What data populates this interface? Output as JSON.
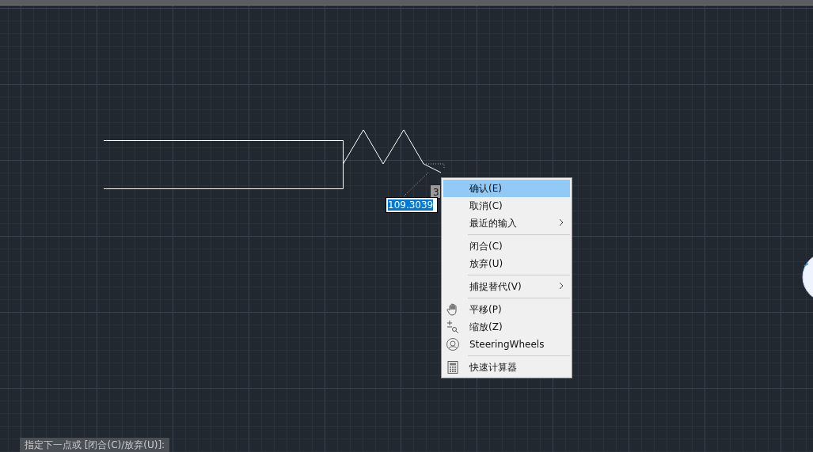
{
  "dimension_input": {
    "value": "109.3039"
  },
  "angle_tooltip": {
    "text": "3"
  },
  "context_menu": {
    "items": [
      {
        "kind": "text",
        "label": "确认(E)",
        "selected": true,
        "submenu": false
      },
      {
        "kind": "text",
        "label": "取消(C)",
        "selected": false,
        "submenu": false
      },
      {
        "kind": "text",
        "label": "最近的输入",
        "selected": false,
        "submenu": true
      },
      {
        "kind": "separator"
      },
      {
        "kind": "text",
        "label": "闭合(C)",
        "selected": false,
        "submenu": false
      },
      {
        "kind": "text",
        "label": "放弃(U)",
        "selected": false,
        "submenu": false
      },
      {
        "kind": "separator"
      },
      {
        "kind": "text",
        "label": "捕捉替代(V)",
        "selected": false,
        "submenu": true
      },
      {
        "kind": "separator"
      },
      {
        "kind": "hand",
        "label": "平移(P)",
        "selected": false,
        "submenu": false
      },
      {
        "kind": "zoom",
        "label": "缩放(Z)",
        "selected": false,
        "submenu": false
      },
      {
        "kind": "wheel",
        "label": "SteeringWheels",
        "selected": false,
        "submenu": false
      },
      {
        "kind": "separator"
      },
      {
        "kind": "calculator",
        "label": "快速计算器",
        "selected": false,
        "submenu": false
      }
    ]
  },
  "command_line": {
    "text": "指定下一点或 [闭合(C)/放弃(U)]:"
  }
}
